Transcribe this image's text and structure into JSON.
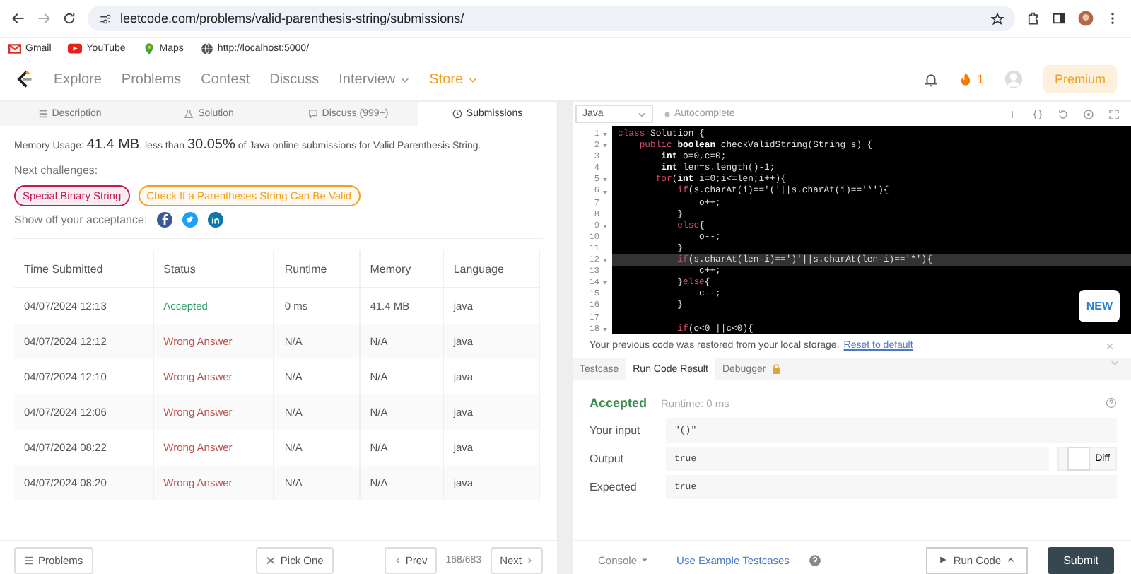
{
  "browser": {
    "url": "leetcode.com/problems/valid-parenthesis-string/submissions/",
    "bookmarks": [
      {
        "label": "Gmail",
        "kind": "mail"
      },
      {
        "label": "YouTube",
        "kind": "video"
      },
      {
        "label": "Maps",
        "kind": "pin"
      },
      {
        "label": "http://localhost:5000/",
        "kind": "globe"
      }
    ]
  },
  "nav": {
    "items": [
      {
        "label": "Explore",
        "kind": "link"
      },
      {
        "label": "Problems",
        "kind": "link"
      },
      {
        "label": "Contest",
        "kind": "link"
      },
      {
        "label": "Discuss",
        "kind": "link"
      },
      {
        "label": "Interview",
        "kind": "menu"
      },
      {
        "label": "Store",
        "kind": "shop"
      }
    ],
    "streak": "1",
    "premium": "Premium"
  },
  "left_tabs": [
    {
      "label": "Description",
      "selected": false,
      "kind": "doc"
    },
    {
      "label": "Solution",
      "selected": false,
      "kind": "flask"
    },
    {
      "label": "Discuss (999+)",
      "selected": false,
      "kind": "chat"
    },
    {
      "label": "Submissions",
      "selected": true,
      "kind": "clock"
    }
  ],
  "summary": {
    "segments": [
      {
        "text": "Memory Usage: ",
        "kind": "small"
      },
      {
        "text": "41.4 MB",
        "kind": "big"
      },
      {
        "text": ", less than ",
        "kind": "small"
      },
      {
        "text": "30.05%",
        "kind": "big"
      },
      {
        "text": " of Java online submissions for Valid Parenthesis String.",
        "kind": "small"
      }
    ],
    "next_label": "Next challenges:",
    "challenges": [
      {
        "label": "Special Binary String",
        "color": "#c2185b"
      },
      {
        "label": "Check If a Parentheses String Can Be Valid",
        "color": "#f0a020"
      }
    ],
    "share_label": "Show off your acceptance:"
  },
  "table": {
    "columns": [
      "Time Submitted",
      "Status",
      "Runtime",
      "Memory",
      "Language"
    ],
    "rows": [
      {
        "time": "04/07/2024 12:13",
        "status": "Accepted",
        "kind": "accepted",
        "runtime": "0 ms",
        "memory": "41.4 MB",
        "language": "java"
      },
      {
        "time": "04/07/2024 12:12",
        "status": "Wrong Answer",
        "kind": "wrong",
        "runtime": "N/A",
        "memory": "N/A",
        "language": "java"
      },
      {
        "time": "04/07/2024 12:10",
        "status": "Wrong Answer",
        "kind": "wrong",
        "runtime": "N/A",
        "memory": "N/A",
        "language": "java"
      },
      {
        "time": "04/07/2024 12:06",
        "status": "Wrong Answer",
        "kind": "wrong",
        "runtime": "N/A",
        "memory": "N/A",
        "language": "java"
      },
      {
        "time": "04/07/2024 08:22",
        "status": "Wrong Answer",
        "kind": "wrong",
        "runtime": "N/A",
        "memory": "N/A",
        "language": "java"
      },
      {
        "time": "04/07/2024 08:20",
        "status": "Wrong Answer",
        "kind": "wrong",
        "runtime": "N/A",
        "memory": "N/A",
        "language": "java"
      }
    ]
  },
  "left_footer": {
    "problems": "Problems",
    "pick": "Pick One",
    "prev": "Prev",
    "page": "168/683",
    "next": "Next"
  },
  "editor": {
    "language": "Java",
    "autocomplete": "Autocomplete",
    "new_badge": "NEW",
    "lines": [
      {
        "number": "1",
        "fold": true,
        "highlighted": false,
        "tokens": [
          {
            "text": "class ",
            "kind": "kw"
          },
          {
            "text": "Solution {",
            "kind": "plain"
          }
        ]
      },
      {
        "number": "2",
        "fold": true,
        "highlighted": false,
        "tokens": [
          {
            "text": "    public ",
            "kind": "kw"
          },
          {
            "text": "boolean",
            "kind": "type"
          },
          {
            "text": " checkValidString(String s) {",
            "kind": "plain"
          }
        ]
      },
      {
        "number": "3",
        "fold": false,
        "highlighted": false,
        "tokens": [
          {
            "text": "        int",
            "kind": "type"
          },
          {
            "text": " o=0,c=0;",
            "kind": "plain"
          }
        ]
      },
      {
        "number": "4",
        "fold": false,
        "highlighted": false,
        "tokens": [
          {
            "text": "        int",
            "kind": "type"
          },
          {
            "text": " len=s.length()-1;",
            "kind": "plain"
          }
        ]
      },
      {
        "number": "5",
        "fold": true,
        "highlighted": false,
        "tokens": [
          {
            "text": "       for",
            "kind": "kw"
          },
          {
            "text": "(",
            "kind": "plain"
          },
          {
            "text": "int",
            "kind": "type"
          },
          {
            "text": " i=0;i<=len;i++){",
            "kind": "plain"
          }
        ]
      },
      {
        "number": "6",
        "fold": true,
        "highlighted": false,
        "tokens": [
          {
            "text": "           if",
            "kind": "kw"
          },
          {
            "text": "(s.charAt(i)=='('||s.charAt(i)=='*'){",
            "kind": "plain"
          }
        ]
      },
      {
        "number": "7",
        "fold": false,
        "highlighted": false,
        "tokens": [
          {
            "text": "               o++;",
            "kind": "plain"
          }
        ]
      },
      {
        "number": "8",
        "fold": false,
        "highlighted": false,
        "tokens": [
          {
            "text": "           }",
            "kind": "plain"
          }
        ]
      },
      {
        "number": "9",
        "fold": true,
        "highlighted": false,
        "tokens": [
          {
            "text": "           else",
            "kind": "kw"
          },
          {
            "text": "{",
            "kind": "plain"
          }
        ]
      },
      {
        "number": "10",
        "fold": false,
        "highlighted": false,
        "tokens": [
          {
            "text": "               o--;",
            "kind": "plain"
          }
        ]
      },
      {
        "number": "11",
        "fold": false,
        "highlighted": false,
        "tokens": [
          {
            "text": "           }",
            "kind": "plain"
          }
        ]
      },
      {
        "number": "12",
        "fold": true,
        "highlighted": true,
        "tokens": [
          {
            "text": "           if",
            "kind": "kw"
          },
          {
            "text": "(s.charAt(len-i)==')'||s.charAt(len-i)=='*'){",
            "kind": "plain"
          }
        ]
      },
      {
        "number": "13",
        "fold": false,
        "highlighted": false,
        "tokens": [
          {
            "text": "               c++;",
            "kind": "plain"
          }
        ]
      },
      {
        "number": "14",
        "fold": true,
        "highlighted": false,
        "tokens": [
          {
            "text": "           }",
            "kind": "plain"
          },
          {
            "text": "else",
            "kind": "kw"
          },
          {
            "text": "{",
            "kind": "plain"
          }
        ]
      },
      {
        "number": "15",
        "fold": false,
        "highlighted": false,
        "tokens": [
          {
            "text": "               c--;",
            "kind": "plain"
          }
        ]
      },
      {
        "number": "16",
        "fold": false,
        "highlighted": false,
        "tokens": [
          {
            "text": "           }",
            "kind": "plain"
          }
        ]
      },
      {
        "number": "17",
        "fold": false,
        "highlighted": false
      },
      {
        "number": "18",
        "fold": true,
        "highlighted": false,
        "tokens": [
          {
            "text": "           if",
            "kind": "kw"
          },
          {
            "text": "(o<0 ||c<0){",
            "kind": "plain"
          }
        ]
      }
    ]
  },
  "notice": {
    "text": "Your previous code was restored from your local storage.",
    "link": "Reset to default"
  },
  "bottom_tabs": [
    {
      "label": "Testcase",
      "selected": false,
      "locked": false
    },
    {
      "label": "Run Code Result",
      "selected": true,
      "locked": false
    },
    {
      "label": "Debugger",
      "selected": false,
      "locked": true
    }
  ],
  "result": {
    "status": "Accepted",
    "runtime": "Runtime: 0 ms",
    "fields": [
      {
        "label": "Your input",
        "value": "\"()\"",
        "kind": "plain"
      },
      {
        "label": "Output",
        "value": "true",
        "kind": "diff"
      },
      {
        "label": "Expected",
        "value": "true",
        "kind": "plain"
      }
    ],
    "diff": "Diff"
  },
  "right_footer": {
    "console": "Console",
    "example": "Use Example Testcases",
    "run": "Run Code",
    "submit": "Submit"
  }
}
